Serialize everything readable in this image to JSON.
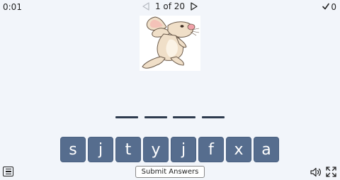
{
  "header": {
    "timer": "0:01",
    "page_indicator": "1 of 20",
    "score": "0"
  },
  "picture": {
    "icon": "rabbit-clipart"
  },
  "answer": {
    "blank_count": 4
  },
  "letter_tiles": [
    "s",
    "j",
    "t",
    "y",
    "j",
    "f",
    "x",
    "a"
  ],
  "footer": {
    "submit_label": "Submit Answers"
  },
  "colors": {
    "tile_bg": "#566d8e",
    "page_bg": "#f2f5fa",
    "blank_line": "#2e3b4e"
  }
}
